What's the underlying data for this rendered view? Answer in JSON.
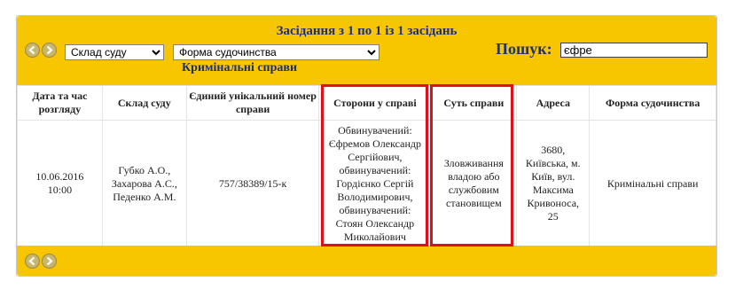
{
  "header": {
    "title": "Засідання з 1 по 1 із 1 засідань",
    "court_select_value": "Склад суду",
    "form_select_value": "Форма судочинства",
    "subtitle": "Кримінальні справи",
    "search_label": "Пошук:",
    "search_value": "єфре"
  },
  "table": {
    "columns": [
      "Дата та час розгляду",
      "Склад суду",
      "Єдиний унікальний номер справи",
      "Сторони у справі",
      "Суть справи",
      "Адреса",
      "Форма судочинства"
    ],
    "rows": [
      {
        "date": "10.06.2016 10:00",
        "court": "Губко А.О., Захарова А.С., Педенко А.М.",
        "case_number": "757/38389/15-к",
        "parties": "Обвинувачений: Єфремов Олександр Сергійович, обвинувачений: Гордієнко Сергій Володимирович, обвинувачений: Стоян Олександр Миколайович",
        "case_essence": "Зловживання владою або службовим становищем",
        "address": "3680, Київська, м. Київ, вул. Максима Кривоноса, 25",
        "form": "Кримінальні справи"
      }
    ]
  },
  "colors": {
    "bar": "#f7c600",
    "title_text": "#1f2f7a",
    "highlight": "#e0101a"
  },
  "icons": [
    "prev-arrow-icon",
    "next-arrow-icon"
  ]
}
